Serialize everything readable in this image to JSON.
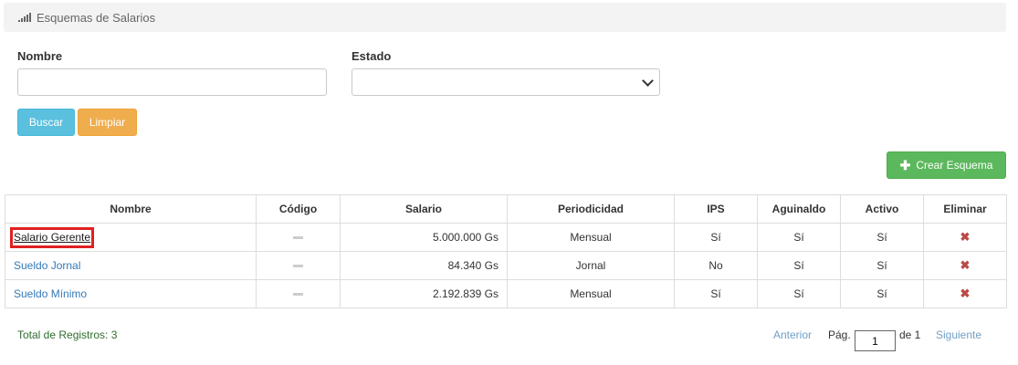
{
  "header": {
    "title": "Esquemas de Salarios",
    "icon": "signal-bars-icon"
  },
  "filters": {
    "nombre_label": "Nombre",
    "nombre_value": "",
    "estado_label": "Estado",
    "estado_value": ""
  },
  "buttons": {
    "buscar": "Buscar",
    "limpiar": "Limpiar",
    "crear": "Crear Esquema",
    "crear_icon": "plus-icon"
  },
  "table": {
    "headers": [
      "Nombre",
      "Código",
      "Salario",
      "Periodicidad",
      "IPS",
      "Aguinaldo",
      "Activo",
      "Eliminar"
    ],
    "rows": [
      {
        "nombre": "Salario Gerente",
        "codigo": "",
        "salario": "5.000.000 Gs",
        "periodicidad": "Mensual",
        "ips": "Sí",
        "aguinaldo": "Sí",
        "activo": "Sí",
        "eliminar": "✖"
      },
      {
        "nombre": "Sueldo Jornal",
        "codigo": "",
        "salario": "84.340 Gs",
        "periodicidad": "Jornal",
        "ips": "No",
        "aguinaldo": "Sí",
        "activo": "Sí",
        "eliminar": "✖"
      },
      {
        "nombre": "Sueldo Mínimo",
        "codigo": "",
        "salario": "2.192.839 Gs",
        "periodicidad": "Mensual",
        "ips": "Sí",
        "aguinaldo": "Sí",
        "activo": "Sí",
        "eliminar": "✖"
      }
    ]
  },
  "footer": {
    "total": "Total de Registros: 3",
    "anterior": "Anterior",
    "pag_label": "Pág.",
    "page_value": "1",
    "de_label": "de 1",
    "siguiente": "Siguiente"
  },
  "colors": {
    "info": "#5bc0de",
    "warning": "#f0ad4e",
    "success": "#5cb85c",
    "link": "#337ab7",
    "danger": "#b94a48",
    "highlight": "#e02020"
  }
}
